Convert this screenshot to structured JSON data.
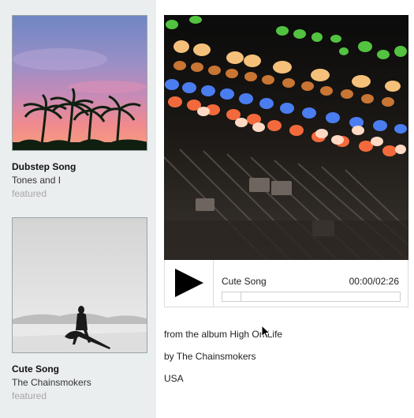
{
  "sidebar": {
    "cards": [
      {
        "title": "Dubstep Song",
        "artist": "Tones and I",
        "tag": "featured"
      },
      {
        "title": "Cute Song",
        "artist": "The Chainsmokers",
        "tag": "featured"
      }
    ]
  },
  "player": {
    "track_title": "Cute Song",
    "time": "00:00/02:26",
    "progress_fraction": 0,
    "play_icon": "play-icon"
  },
  "details": {
    "album": "from the album High On Life",
    "artist": "by The Chainsmokers",
    "country": "USA"
  },
  "colors": {
    "sidebar_bg": "#ebeeef",
    "muted_text": "#a6a6a6"
  }
}
